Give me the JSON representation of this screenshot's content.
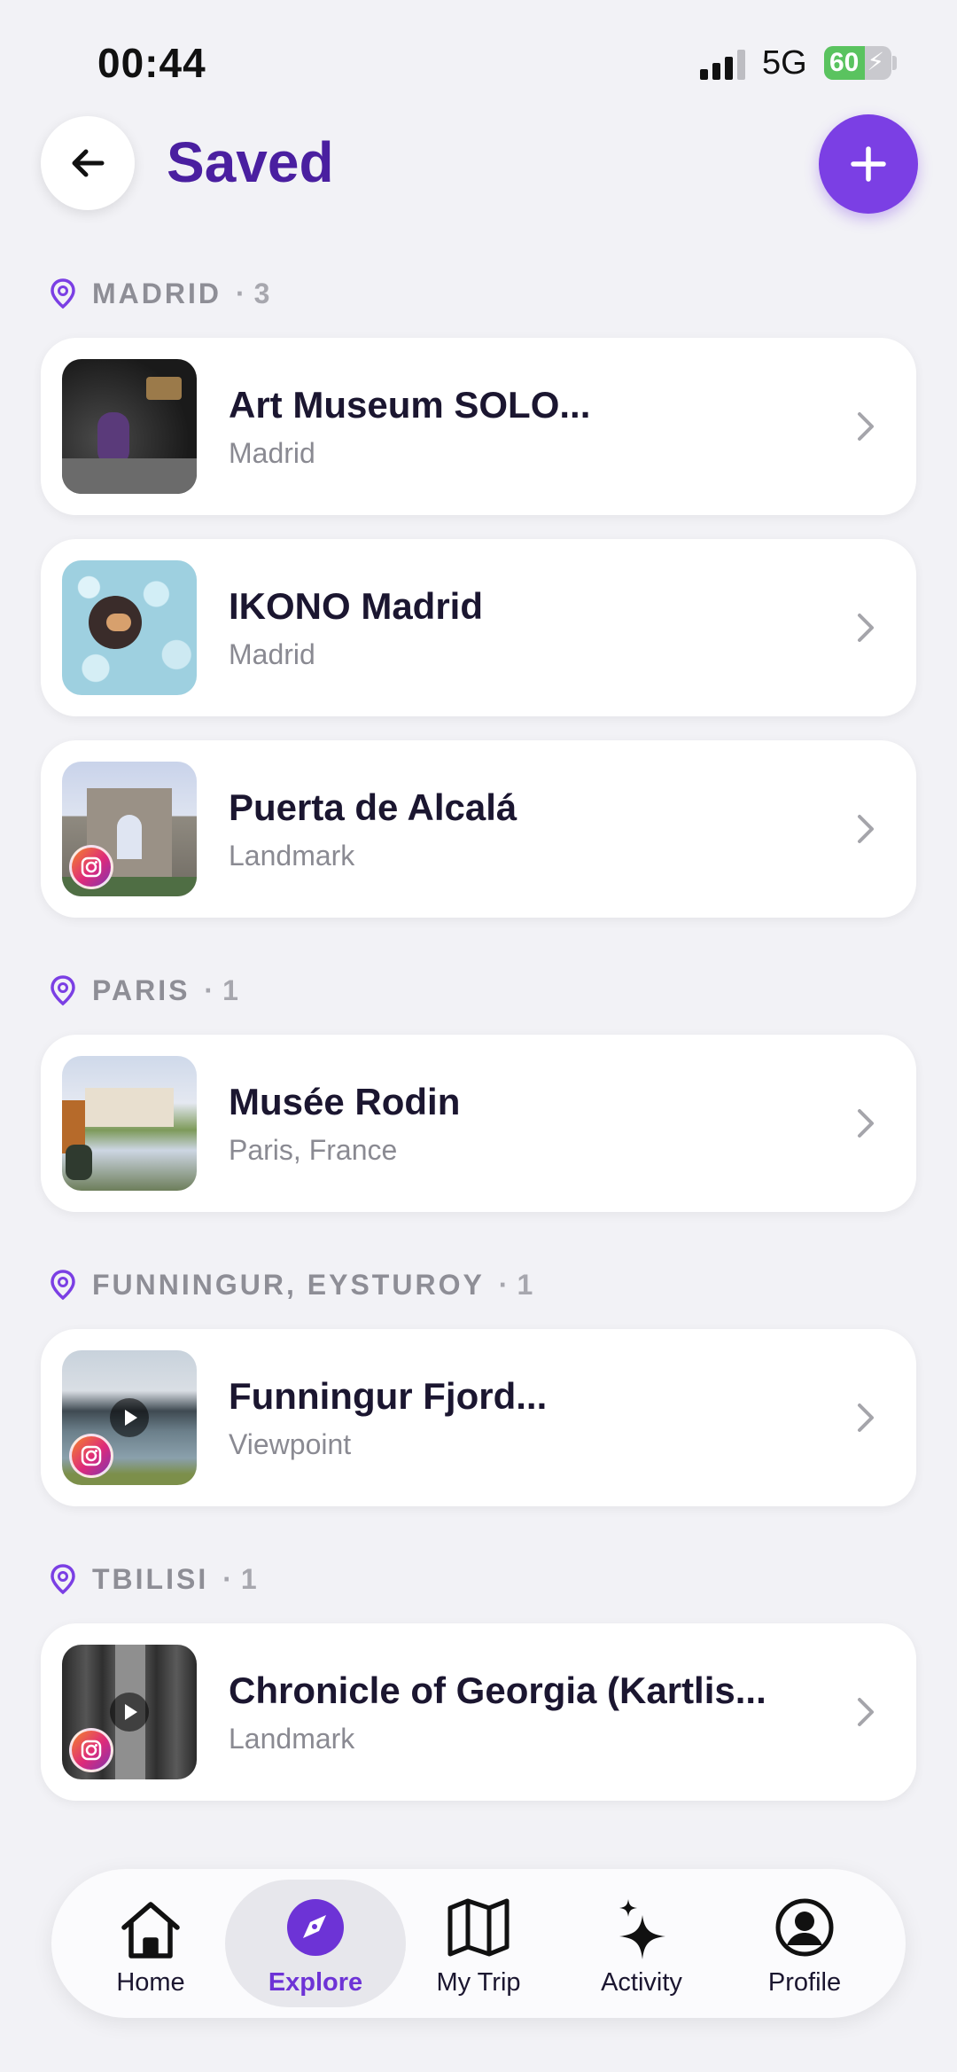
{
  "status_bar": {
    "time": "00:44",
    "network": "5G",
    "battery": "60"
  },
  "header": {
    "title": "Saved"
  },
  "sections": [
    {
      "name": "MADRID",
      "separator": "·",
      "count": "3",
      "items": [
        {
          "title": "Art Museum SOLO...",
          "subtitle": "Madrid",
          "badges": []
        },
        {
          "title": "IKONO Madrid",
          "subtitle": "Madrid",
          "badges": []
        },
        {
          "title": "Puerta de Alcalá",
          "subtitle": "Landmark",
          "badges": [
            "instagram-icon"
          ]
        }
      ]
    },
    {
      "name": "PARIS",
      "separator": "·",
      "count": "1",
      "items": [
        {
          "title": "Musée Rodin",
          "subtitle": "Paris, France",
          "badges": []
        }
      ]
    },
    {
      "name": "FUNNINGUR, EYSTUROY",
      "separator": "·",
      "count": "1",
      "items": [
        {
          "title": "Funningur Fjord...",
          "subtitle": "Viewpoint",
          "badges": [
            "instagram-icon",
            "play-icon"
          ]
        }
      ]
    },
    {
      "name": "TBILISI",
      "separator": "·",
      "count": "1",
      "items": [
        {
          "title": "Chronicle of Georgia (Kartlis...",
          "subtitle": "Landmark",
          "badges": [
            "instagram-icon",
            "play-icon"
          ]
        }
      ]
    }
  ],
  "tabbar": {
    "tabs": [
      {
        "label": "Home",
        "icon": "home-icon"
      },
      {
        "label": "Explore",
        "icon": "compass-icon",
        "active": true
      },
      {
        "label": "My Trip",
        "icon": "map-icon"
      },
      {
        "label": "Activity",
        "icon": "sparkles-icon"
      },
      {
        "label": "Profile",
        "icon": "profile-icon"
      }
    ]
  },
  "colors": {
    "accent": "#7b3fe4",
    "title": "#4a1fa0",
    "background": "#f2f2f6"
  }
}
